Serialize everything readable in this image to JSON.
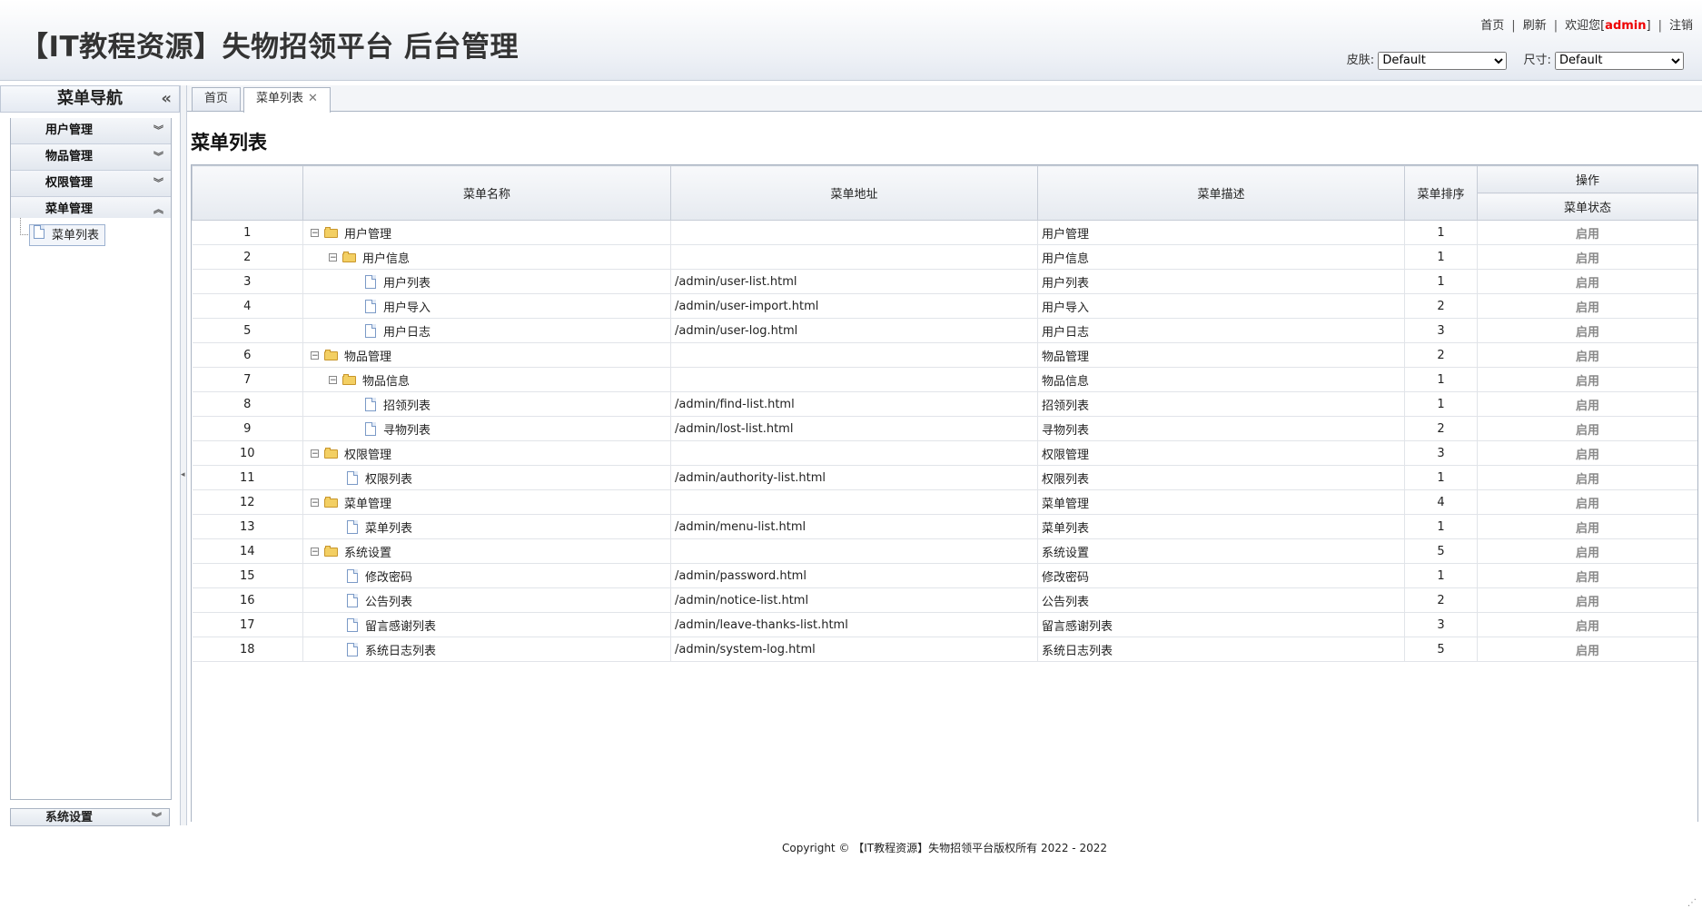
{
  "header": {
    "title": "【IT教程资源】失物招领平台 后台管理",
    "links": {
      "home": "首页",
      "refresh": "刷新",
      "welcome_prefix": "欢迎您[",
      "user": "admin",
      "welcome_suffix": "]",
      "logout": "注销"
    },
    "skin_label": "皮肤:",
    "skin_value": "Default",
    "size_label": "尺寸:",
    "size_value": "Default"
  },
  "sidebar": {
    "title": "菜单导航",
    "groups": [
      {
        "label": "用户管理"
      },
      {
        "label": "物品管理"
      },
      {
        "label": "权限管理"
      },
      {
        "label": "菜单管理"
      }
    ],
    "active_item": "菜单列表",
    "bottom_group": "系统设置"
  },
  "tabs": [
    {
      "label": "首页"
    },
    {
      "label": "菜单列表"
    }
  ],
  "page_title": "菜单列表",
  "table": {
    "headers": {
      "name": "菜单名称",
      "url": "菜单地址",
      "desc": "菜单描述",
      "order": "菜单排序",
      "ops": "操作",
      "status": "菜单状态"
    },
    "rows": [
      {
        "no": "1",
        "name": "用户管理",
        "url": "",
        "desc": "用户管理",
        "order": "1",
        "status": "启用"
      },
      {
        "no": "2",
        "name": "用户信息",
        "url": "",
        "desc": "用户信息",
        "order": "1",
        "status": "启用"
      },
      {
        "no": "3",
        "name": "用户列表",
        "url": "/admin/user-list.html",
        "desc": "用户列表",
        "order": "1",
        "status": "启用"
      },
      {
        "no": "4",
        "name": "用户导入",
        "url": "/admin/user-import.html",
        "desc": "用户导入",
        "order": "2",
        "status": "启用"
      },
      {
        "no": "5",
        "name": "用户日志",
        "url": "/admin/user-log.html",
        "desc": "用户日志",
        "order": "3",
        "status": "启用"
      },
      {
        "no": "6",
        "name": "物品管理",
        "url": "",
        "desc": "物品管理",
        "order": "2",
        "status": "启用"
      },
      {
        "no": "7",
        "name": "物品信息",
        "url": "",
        "desc": "物品信息",
        "order": "1",
        "status": "启用"
      },
      {
        "no": "8",
        "name": "招领列表",
        "url": "/admin/find-list.html",
        "desc": "招领列表",
        "order": "1",
        "status": "启用"
      },
      {
        "no": "9",
        "name": "寻物列表",
        "url": "/admin/lost-list.html",
        "desc": "寻物列表",
        "order": "2",
        "status": "启用"
      },
      {
        "no": "10",
        "name": "权限管理",
        "url": "",
        "desc": "权限管理",
        "order": "3",
        "status": "启用"
      },
      {
        "no": "11",
        "name": "权限列表",
        "url": "/admin/authority-list.html",
        "desc": "权限列表",
        "order": "1",
        "status": "启用"
      },
      {
        "no": "12",
        "name": "菜单管理",
        "url": "",
        "desc": "菜单管理",
        "order": "4",
        "status": "启用"
      },
      {
        "no": "13",
        "name": "菜单列表",
        "url": "/admin/menu-list.html",
        "desc": "菜单列表",
        "order": "1",
        "status": "启用"
      },
      {
        "no": "14",
        "name": "系统设置",
        "url": "",
        "desc": "系统设置",
        "order": "5",
        "status": "启用"
      },
      {
        "no": "15",
        "name": "修改密码",
        "url": "/admin/password.html",
        "desc": "修改密码",
        "order": "1",
        "status": "启用"
      },
      {
        "no": "16",
        "name": "公告列表",
        "url": "/admin/notice-list.html",
        "desc": "公告列表",
        "order": "2",
        "status": "启用"
      },
      {
        "no": "17",
        "name": "留言感谢列表",
        "url": "/admin/leave-thanks-list.html",
        "desc": "留言感谢列表",
        "order": "3",
        "status": "启用"
      },
      {
        "no": "18",
        "name": "系统日志列表",
        "url": "/admin/system-log.html",
        "desc": "系统日志列表",
        "order": "5",
        "status": "启用"
      }
    ]
  },
  "footer": "Copyright © 【IT教程资源】失物招领平台版权所有  2022 - 2022"
}
